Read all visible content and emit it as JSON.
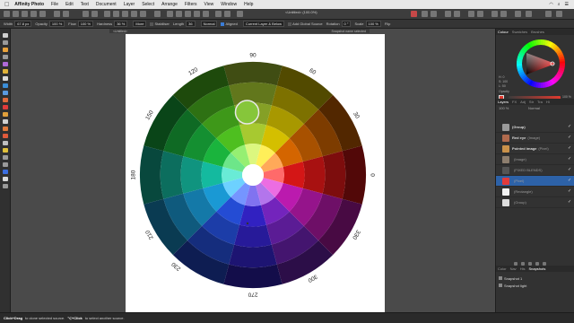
{
  "menubar": {
    "app": "Affinity Photo",
    "items": [
      "File",
      "Edit",
      "Text",
      "Document",
      "Layer",
      "Select",
      "Arrange",
      "Filters",
      "View",
      "Window",
      "Help"
    ]
  },
  "toolbar": {
    "document_title": "<Untitled> (100.0%)"
  },
  "context": {
    "width_label": "Width",
    "width_value": "67.8 px",
    "opacity_label": "Opacity",
    "opacity_value": "100 %",
    "flow_label": "Flow",
    "flow_value": "100 %",
    "hardness_label": "Hardness",
    "hardness_value": "36 %",
    "more_label": "More",
    "stabiliser_label": "Stabiliser",
    "length_label": "Length",
    "length_value": "36",
    "blend_value": "Normal",
    "aligned_label": "Aligned",
    "source_value": "Current Layer & Below",
    "global_source_label": "Add Global Source",
    "rotation_label": "Rotation",
    "rotation_value": "0 °",
    "scale_label": "Scale",
    "scale_value": "100 %",
    "flip_label": "Flip"
  },
  "canvas": {
    "tab_title": "<Untitled>",
    "tab_right": "Snapshot name selected",
    "wheel_labels": [
      "0",
      "30",
      "60",
      "90",
      "120",
      "150",
      "180",
      "210",
      "230",
      "270",
      "300",
      "330"
    ],
    "chart_data": {
      "type": "pie",
      "title": "",
      "categories": [
        "0",
        "30",
        "60",
        "90",
        "120",
        "150",
        "180",
        "210",
        "230",
        "270",
        "300",
        "330"
      ],
      "values": [
        30,
        30,
        30,
        30,
        30,
        30,
        30,
        30,
        30,
        30,
        30,
        30
      ],
      "rings": 5,
      "colors": [
        "#ff1a1a",
        "#ff7a00",
        "#ffe600",
        "#c9f23a",
        "#5ee626",
        "#1fd94a",
        "#18e0c0",
        "#1fb8ff",
        "#2b5cff",
        "#3b28e8",
        "#8a2be2",
        "#e11fd2"
      ]
    }
  },
  "panel": {
    "colour_tabs": [
      "Colour",
      "Swatches",
      "Brushes"
    ],
    "h_label": "H: 0",
    "s_label": "S: 100",
    "l_label": "L: 50",
    "opacity_label": "Opacity",
    "opacity_value": "100 %",
    "layer_tabs": [
      "Layers",
      "FX",
      "Adj",
      "Str",
      "Tra",
      "Hi"
    ],
    "opacity_field": "100 %",
    "blend_field": "Normal",
    "layers": [
      {
        "name": "(Group)",
        "kind": "",
        "color": "#9a9a9a",
        "selected": false
      },
      {
        "name": "Red eye",
        "kind": "(Image)",
        "color": "#b06a4d",
        "selected": false
      },
      {
        "name": "Pointed image",
        "kind": "(Pixel)",
        "color": "#c9914a",
        "selected": false
      },
      {
        "name": "",
        "kind": "(Image)",
        "color": "#8d7e6e",
        "selected": false
      },
      {
        "name": "",
        "kind": "(FIXED BLENDS)",
        "color": "#555555",
        "selected": false
      },
      {
        "name": "",
        "kind": "(Pixel)",
        "color": "#e23b3b",
        "selected": true
      },
      {
        "name": "",
        "kind": "(Rectangle)",
        "color": "#f2f2f2",
        "selected": false
      },
      {
        "name": "",
        "kind": "(Group)",
        "color": "#dddddd",
        "selected": false
      }
    ],
    "bottom_tabs": [
      "Color",
      "Nav",
      "His",
      "Snapshots"
    ],
    "snapshots": [
      "Snapshot 1",
      "Snapshot light"
    ]
  },
  "status": {
    "drag_label": "Click+Drag",
    "drag_text": "to clone selected source.",
    "click_label": "⌥+Click",
    "click_text": "to select another source."
  }
}
